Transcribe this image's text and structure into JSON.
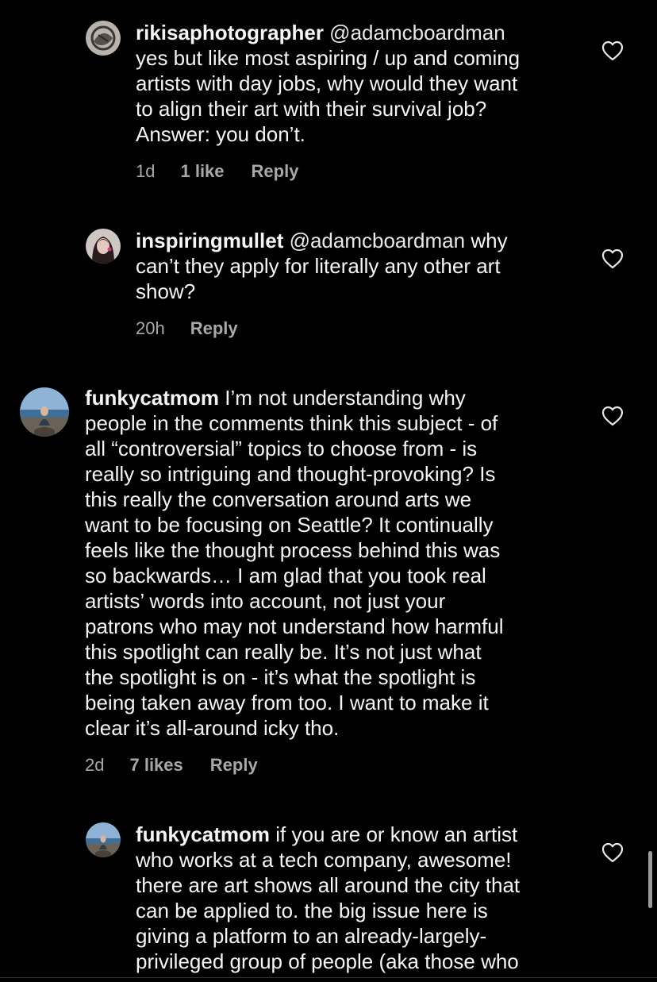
{
  "comments": [
    {
      "username": "rikisaphotographer",
      "mention": "@adamcboardman",
      "text_lines": [
        "yes but like most aspiring / up and coming",
        "artists with day jobs, why would they want",
        "to align their art with their survival job?",
        "Answer:  you don’t."
      ],
      "time": "1d",
      "likes": "1 like",
      "reply": "Reply",
      "avatar_icon": "sketch-avatar"
    },
    {
      "username": "inspiringmullet",
      "mention": "@adamcboardman",
      "first_line_tail": "why",
      "text_lines": [
        "can’t they apply for literally any other art",
        "show?"
      ],
      "time": "20h",
      "likes": "",
      "reply": "Reply",
      "avatar_icon": "person-avatar"
    },
    {
      "username": "funkycatmom",
      "mention": "",
      "first_line_tail": "I’m not understanding why",
      "text_lines": [
        "people in the comments think this subject - of",
        "all “controversial” topics to choose from - is",
        "really so intriguing and thought-provoking? Is",
        "this really the conversation around arts we",
        "want to be focusing on Seattle? It continually",
        "feels like the thought process behind this was",
        "so backwards… I am glad that you took real",
        "artists’ words into account, not just your",
        "patrons who may not understand how harmful",
        "this spotlight can really be. It’s not just what",
        "the spotlight is on - it’s what the spotlight is",
        "being taken away from too. I want to make it",
        "clear it’s all-around icky tho."
      ],
      "time": "2d",
      "likes": "7 likes",
      "reply": "Reply",
      "avatar_icon": "beach-avatar"
    },
    {
      "username": "funkycatmom",
      "mention": "",
      "first_line_tail": "if you are or know an artist",
      "text_lines": [
        "who works at a tech company, awesome!",
        "there are art shows all around the city that",
        "can be applied to. the big issue here is",
        "giving a platform to an already-largely-",
        "privileged group of people (aka those who"
      ],
      "time": "",
      "likes": "",
      "reply": "",
      "avatar_icon": "beach-avatar"
    }
  ],
  "colors": {
    "background": "#000000",
    "text": "#f5f5f5",
    "meta": "#a8a8a8"
  },
  "icons": {
    "like": "heart-outline-icon"
  }
}
